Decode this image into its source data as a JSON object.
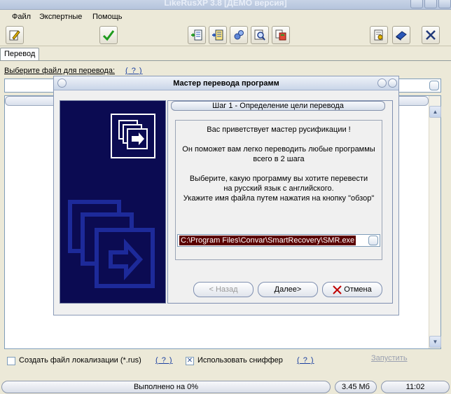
{
  "window": {
    "title": "LikeRusXP 3.8  [ДЕМО версия]"
  },
  "menu": {
    "items": [
      "Файл",
      "Экспертные",
      "Помощь"
    ]
  },
  "toolbar": {
    "icons": [
      "edit-icon",
      "check-icon",
      "import-icon",
      "export-icon",
      "settings-icon",
      "search-icon",
      "dictionary-icon",
      "certificate-icon",
      "book-icon",
      "close-icon"
    ]
  },
  "tabs": [
    "Перевод"
  ],
  "main": {
    "file_label": "Выберите файл для перевода:",
    "help": "( ? )"
  },
  "dialog": {
    "title": "Мастер перевода программ",
    "step": "Шаг 1 - Определение цели перевода",
    "greeting": "Вас приветствует мастер русификации !",
    "info_line1": "Он поможет вам легко переводить любые программы",
    "info_line2": "всего в 2 шага",
    "choose_line1": "Выберите, какую программу вы хотите перевести",
    "choose_line2": "на русский язык с английского.",
    "choose_line3": "Укажите имя файла путем нажатия на кнопку \"обзор\"",
    "path": "C:\\Program Files\\Convar\\SmartRecovery\\SMR.exe",
    "back": "< Назад",
    "next": "Далее>",
    "cancel": "Отмена"
  },
  "bottom": {
    "create_loc": "Создать файл локализации (*.rus)",
    "create_loc_checked": false,
    "help1": "( ? )",
    "use_sniffer": "Использовать сниффер",
    "use_sniffer_checked": true,
    "help2": "( ? )",
    "run": "Запустить"
  },
  "status": {
    "progress_text": "Выполнено на 0%",
    "size": "3.45 Мб",
    "time": "11:02"
  },
  "colors": {
    "side_panel": "#0b0b52",
    "path_highlight": "#5a0000",
    "cancel_x": "#c00000",
    "check_green": "#1e9b1e"
  }
}
